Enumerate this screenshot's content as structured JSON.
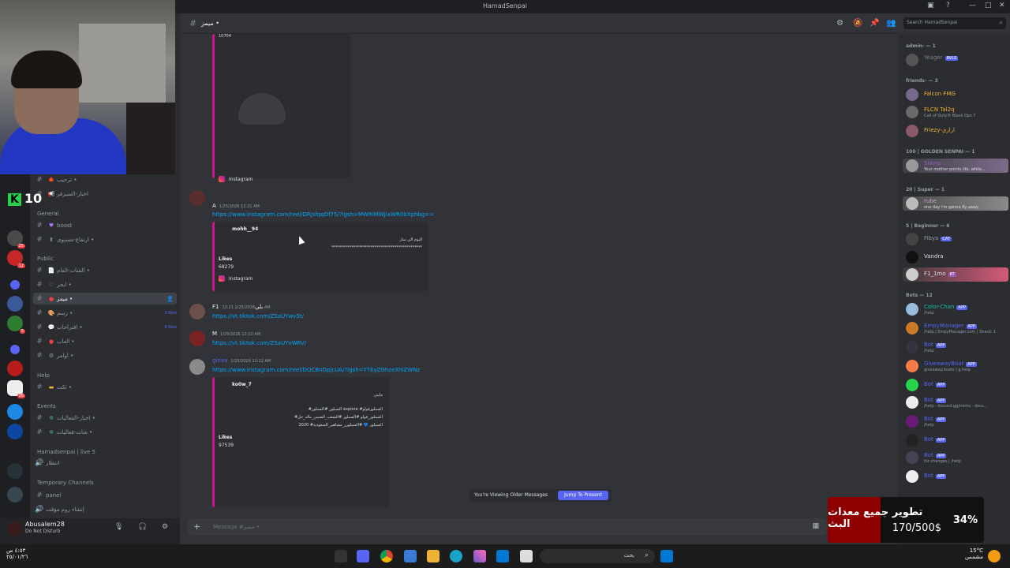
{
  "window": {
    "title": "HamadSenpai"
  },
  "channel_header": {
    "name": "ميمز •",
    "search_placeholder": "Search HamadSenpai"
  },
  "counter": {
    "value": "10"
  },
  "channels": {
    "items": [
      {
        "name": "ترحيب •",
        "category": ""
      },
      {
        "name": "اخبار-السيرفر",
        "category": ""
      },
      {
        "cat": "General"
      },
      {
        "name": "boost"
      },
      {
        "name": "ارتفاع-مستوى •"
      },
      {
        "cat": "Public"
      },
      {
        "name": "الشات-العام •"
      },
      {
        "name": "ابحر •"
      },
      {
        "name": "ميمز •",
        "active": true
      },
      {
        "name": "رسم •",
        "new": "3 New"
      },
      {
        "name": "اقتراحات •",
        "new": "8 New"
      },
      {
        "name": "العاب •"
      },
      {
        "name": "اوامر •"
      },
      {
        "cat": "Help"
      },
      {
        "name": "تكت •"
      },
      {
        "cat": "Events"
      },
      {
        "name": "اخبار-الفعاليات •"
      },
      {
        "name": "شات-فعاليات •"
      },
      {
        "cat": "Hamadsenpai | live 5"
      },
      {
        "name": "انتظار"
      },
      {
        "cat": "Temporary Channels"
      },
      {
        "name": "panel"
      },
      {
        "name": "إنشاء روم مؤقت"
      }
    ]
  },
  "user": {
    "name": "Abusalem28",
    "status": "Do Not Disturb"
  },
  "messages": [
    {
      "embed_a": {
        "partial_author": "10704",
        "footer": "Instagram"
      }
    },
    {
      "author": "A",
      "time": "1/25/2026 12:21 AM",
      "link": "https://www.instagram.com/reel/DRJsfqqDf75/?igsh=MWRlMWJiaWR0bXphbg==",
      "embed": {
        "author": "mohh__94",
        "desc": "اليوم الي سار",
        "desc2": "**********************************************",
        "likes_label": "Likes",
        "likes": "68279",
        "footer": "Instagram"
      }
    },
    {
      "author": "F1بلي",
      "time": "1/25/2026 12:21 AM",
      "link": "https://vt.tiktok.com/ZSaUYwv5t/"
    },
    {
      "author": "M",
      "time": "1/25/2026 12:22 AM",
      "link": "https://vt.tiktok.com/ZSaUYvWRV/"
    },
    {
      "author": "ginva",
      "time": "1/25/2026 12:22 AM",
      "link": "https://www.instagram.com/reel/DOCBnDpjcUA/?igsh=YTEyZGhzeXhiZWNz",
      "embed": {
        "author": "ko0w_7",
        "desc": "مايبي",
        "desc2": "#اكسبلور #اكسبلور explore #اكسبلورفولو",
        "desc3": "#اكسبلور_فولو #اكسبلور #الشعب_الصيني_ماله_حل",
        "desc4": "2020 #اكسبلور 💙 #اكسبلورر_مشاهير_السعودية",
        "likes_label": "Likes",
        "likes": "97539"
      }
    }
  ],
  "older_bar": {
    "text": "You're Viewing Older Messages",
    "button": "Jump To Present"
  },
  "composer": {
    "placeholder": "Message #ميمز •"
  },
  "members": [
    {
      "cat": "admin- — 1"
    },
    {
      "name": "Yeager",
      "tag": "RVLS",
      "color": "#7a7f8a"
    },
    {
      "cat": "friends- — 3"
    },
    {
      "name": "Falcon FMG",
      "color": "#f0b232"
    },
    {
      "name": "FLCN Tal2q",
      "sub": "Call of Duty® Black Ops 7",
      "color": "#f0b232"
    },
    {
      "name": "Friezy-ارازي",
      "color": "#f0b232"
    },
    {
      "cat": "100 | GOLDEN SENPAI — 1"
    },
    {
      "name": "Slayer",
      "sub": "Your mother points life, while...",
      "color": "#9b59b6"
    },
    {
      "cat": "20 | Super — 1"
    },
    {
      "name": "rube",
      "sub": "one day i'm gonna fly away",
      "color": "#c9a0dc"
    },
    {
      "cat": "5 | Beginner — 6"
    },
    {
      "name": "Fibya",
      "tag": "CAT",
      "color": "#949ba4"
    },
    {
      "name": "Vandra",
      "color": "#dbdee1"
    },
    {
      "name": "F1_1mo",
      "tag": "RT",
      "color": "#dbdee1"
    },
    {
      "cat": "Bots — 12"
    },
    {
      "name": "Color-Chan",
      "tag": "APP",
      "sub": "/help",
      "color": "#1abc9c"
    },
    {
      "name": "EmpyManager",
      "tag": "APP",
      "sub": "/help | EmpyManager.com | Shard: 1",
      "color": "#5865f2"
    },
    {
      "name": "Bot",
      "tag": "APP",
      "sub": "/help",
      "color": "#5865f2"
    },
    {
      "name": "GiveawayBoat",
      "tag": "APP",
      "sub": "giveaway.boats | g.help",
      "color": "#5865f2"
    },
    {
      "name": "Bot",
      "tag": "APP",
      "color": "#5865f2"
    },
    {
      "name": "Bot",
      "tag": "APP",
      "sub": "/help · discord.gg/mimu · docs...",
      "color": "#5865f2"
    },
    {
      "name": "Bot",
      "tag": "APP",
      "sub": "/help",
      "color": "#5865f2"
    },
    {
      "name": "Bot",
      "tag": "APP",
      "color": "#5865f2"
    },
    {
      "name": "Bot",
      "tag": "APP",
      "sub": "for changes | /help",
      "color": "#5865f2"
    },
    {
      "name": "Bot",
      "tag": "APP",
      "color": "#5865f2"
    }
  ],
  "overlay": {
    "title": "تطوير جميع معدات البث",
    "amount": "170/500$",
    "progress": 34,
    "progress_label": "34%"
  },
  "taskbar": {
    "search_placeholder": "بحث",
    "time": "٤:٥٣ ص",
    "date": "٢٥/٠١/٢٦",
    "weather": "15°C",
    "weather_desc": "مشمس"
  }
}
